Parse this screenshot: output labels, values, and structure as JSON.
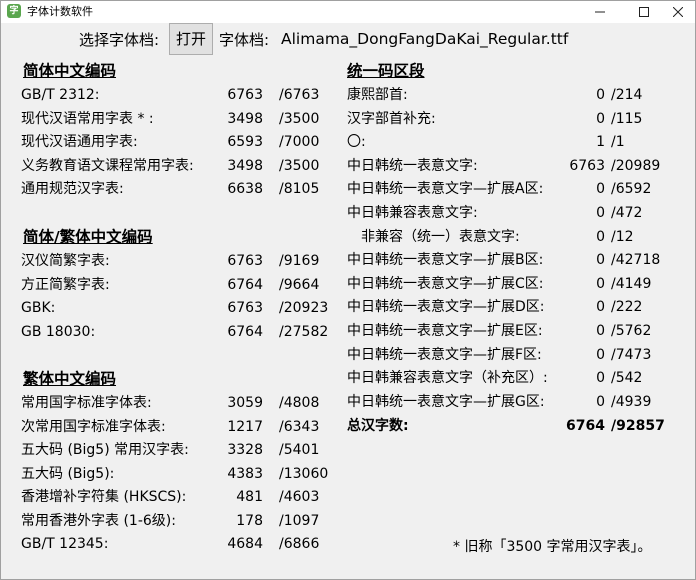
{
  "window": {
    "title": "字体计数软件",
    "icon_glyph": "字"
  },
  "toolbar": {
    "select_label": "选择字体档:",
    "open_label": "打开",
    "font_label": "字体档:",
    "font_file": "Alimama_DongFangDaKai_Regular.ttf"
  },
  "left": {
    "simplified": {
      "title": "简体中文编码",
      "rows": [
        {
          "label": "GB/T 2312:",
          "count": "6763",
          "total": "/6763"
        },
        {
          "label": "现代汉语常用字表 * :",
          "count": "3498",
          "total": "/3500"
        },
        {
          "label": "现代汉语通用字表:",
          "count": "6593",
          "total": "/7000"
        },
        {
          "label": "义务教育语文课程常用字表:",
          "count": "3498",
          "total": "/3500"
        },
        {
          "label": "通用规范汉字表:",
          "count": "6638",
          "total": "/8105"
        }
      ]
    },
    "mixed": {
      "title": "简体/繁体中文编码",
      "rows": [
        {
          "label": "汉仪简繁字表:",
          "count": "6763",
          "total": "/9169"
        },
        {
          "label": "方正简繁字表:",
          "count": "6764",
          "total": "/9664"
        },
        {
          "label": "GBK:",
          "count": "6763",
          "total": "/20923"
        },
        {
          "label": "GB 18030:",
          "count": "6764",
          "total": "/27582"
        }
      ]
    },
    "traditional": {
      "title": "繁体中文编码",
      "rows": [
        {
          "label": "常用国字标准字体表:",
          "count": "3059",
          "total": "/4808"
        },
        {
          "label": "次常用国字标准字体表:",
          "count": "1217",
          "total": "/6343"
        },
        {
          "label": "五大码 (Big5) 常用汉字表:",
          "count": "3328",
          "total": "/5401"
        },
        {
          "label": "五大码 (Big5):",
          "count": "4383",
          "total": "/13060"
        },
        {
          "label": "香港增补字符集 (HKSCS):",
          "count": "481",
          "total": "/4603"
        },
        {
          "label": "常用香港外字表 (1-6级):",
          "count": "178",
          "total": "/1097"
        },
        {
          "label": "GB/T 12345:",
          "count": "4684",
          "total": "/6866"
        }
      ]
    }
  },
  "right": {
    "title": "统一码区段",
    "rows": [
      {
        "label": "康熙部首:",
        "count": "0",
        "total": "/214"
      },
      {
        "label": "汉字部首补充:",
        "count": "0",
        "total": "/115"
      },
      {
        "label": "〇:",
        "count": "1",
        "total": "/1"
      },
      {
        "label": "中日韩统一表意文字:",
        "count": "6763",
        "total": "/20989"
      },
      {
        "label": "中日韩统一表意文字—扩展A区:",
        "count": "0",
        "total": "/6592"
      },
      {
        "label": "中日韩兼容表意文字:",
        "count": "0",
        "total": "/472"
      },
      {
        "label": "非兼容（统一）表意文字:",
        "count": "0",
        "total": "/12"
      },
      {
        "label": "中日韩统一表意文字—扩展B区:",
        "count": "0",
        "total": "/42718"
      },
      {
        "label": "中日韩统一表意文字—扩展C区:",
        "count": "0",
        "total": "/4149"
      },
      {
        "label": "中日韩统一表意文字—扩展D区:",
        "count": "0",
        "total": "/222"
      },
      {
        "label": "中日韩统一表意文字—扩展E区:",
        "count": "0",
        "total": "/5762"
      },
      {
        "label": "中日韩统一表意文字—扩展F区:",
        "count": "0",
        "total": "/7473"
      },
      {
        "label": "中日韩兼容表意文字（补充区）:",
        "count": "0",
        "total": "/542"
      },
      {
        "label": "中日韩统一表意文字—扩展G区:",
        "count": "0",
        "total": "/4939"
      }
    ],
    "summary": {
      "label": "总汉字数:",
      "count": "6764",
      "total": "/92857"
    }
  },
  "footnote": "* 旧称「3500 字常用汉字表」。"
}
